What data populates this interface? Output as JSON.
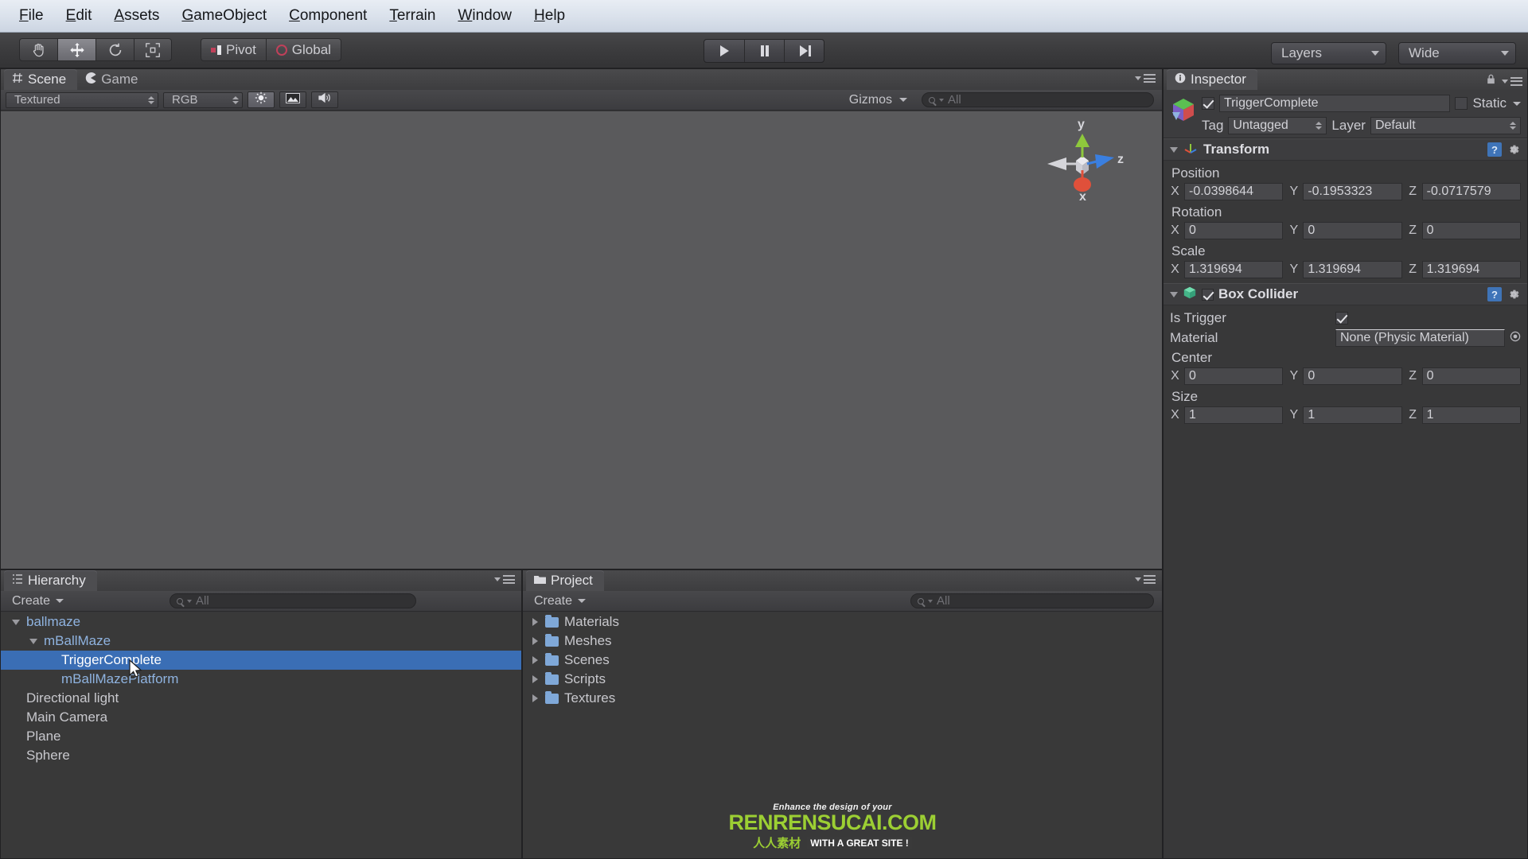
{
  "app": {
    "title": "Unity Editor"
  },
  "menubar": {
    "items": [
      {
        "label": "File",
        "mnemonic": "F"
      },
      {
        "label": "Edit",
        "mnemonic": "E"
      },
      {
        "label": "Assets",
        "mnemonic": "A"
      },
      {
        "label": "GameObject",
        "mnemonic": "G"
      },
      {
        "label": "Component",
        "mnemonic": "C"
      },
      {
        "label": "Terrain",
        "mnemonic": "T"
      },
      {
        "label": "Window",
        "mnemonic": "W"
      },
      {
        "label": "Help",
        "mnemonic": "H"
      }
    ]
  },
  "toolbar": {
    "tools": [
      {
        "name": "hand-tool",
        "icon": "hand-icon",
        "active": false
      },
      {
        "name": "move-tool",
        "icon": "move-arrows-icon",
        "active": true
      },
      {
        "name": "rotate-tool",
        "icon": "rotate-icon",
        "active": false
      },
      {
        "name": "scale-tool",
        "icon": "scale-icon",
        "active": false
      }
    ],
    "pivot_label": "Pivot",
    "global_label": "Global",
    "play_label": "Play",
    "pause_label": "Pause",
    "step_label": "Step",
    "layers_label": "Layers",
    "layout_label": "Wide"
  },
  "scene_panel": {
    "tabs": [
      {
        "label": "Scene",
        "icon": "scene-grid-icon",
        "active": true
      },
      {
        "label": "Game",
        "icon": "game-pacman-icon",
        "active": false
      }
    ],
    "draw_mode": "Textured",
    "render_mode": "RGB",
    "lighting_toggle": "sun-icon",
    "fx_toggle": "image-icon",
    "audio_toggle": "speaker-icon",
    "gizmos_label": "Gizmos",
    "search_placeholder": "All",
    "search_value": "",
    "gizmo_axes": {
      "y": "y",
      "z": "z",
      "x": "x"
    }
  },
  "hierarchy_panel": {
    "tab_label": "Hierarchy",
    "tab_icon": "hierarchy-list-icon",
    "create_label": "Create",
    "search_placeholder": "All",
    "search_value": "",
    "items": [
      {
        "label": "ballmaze",
        "depth": 0,
        "expander": "down",
        "prefab": true,
        "selected": false
      },
      {
        "label": "mBallMaze",
        "depth": 1,
        "expander": "down",
        "prefab": true,
        "selected": false
      },
      {
        "label": "TriggerComplete",
        "depth": 2,
        "expander": "none",
        "prefab": true,
        "selected": true
      },
      {
        "label": "mBallMazePlatform",
        "depth": 2,
        "expander": "none",
        "prefab": true,
        "selected": false
      },
      {
        "label": "Directional light",
        "depth": 0,
        "expander": "none",
        "prefab": false,
        "selected": false
      },
      {
        "label": "Main Camera",
        "depth": 0,
        "expander": "none",
        "prefab": false,
        "selected": false
      },
      {
        "label": "Plane",
        "depth": 0,
        "expander": "none",
        "prefab": false,
        "selected": false
      },
      {
        "label": "Sphere",
        "depth": 0,
        "expander": "none",
        "prefab": false,
        "selected": false
      }
    ]
  },
  "project_panel": {
    "tab_label": "Project",
    "tab_icon": "folder-icon",
    "create_label": "Create",
    "search_placeholder": "All",
    "search_value": "",
    "items": [
      {
        "label": "Materials",
        "expander": "right",
        "icon": "folder-icon"
      },
      {
        "label": "Meshes",
        "expander": "right",
        "icon": "folder-icon"
      },
      {
        "label": "Scenes",
        "expander": "right",
        "icon": "folder-icon"
      },
      {
        "label": "Scripts",
        "expander": "right",
        "icon": "folder-icon"
      },
      {
        "label": "Textures",
        "expander": "right",
        "icon": "folder-icon"
      }
    ]
  },
  "inspector": {
    "tab_label": "Inspector",
    "tab_icon": "info-icon",
    "lock_icon": "lock-icon",
    "object_name": "TriggerComplete",
    "object_enabled": true,
    "static_label": "Static",
    "static_checked": false,
    "tag_label": "Tag",
    "tag_value": "Untagged",
    "layer_label": "Layer",
    "layer_value": "Default",
    "components": [
      {
        "name": "Transform",
        "icon": "transform-axis-icon",
        "has_enable_checkbox": false,
        "enabled": true,
        "expanded": true,
        "properties": [
          {
            "label": "Position",
            "type": "vector3",
            "x": "-0.0398644",
            "y": "-0.1953323",
            "z": "-0.0717579"
          },
          {
            "label": "Rotation",
            "type": "vector3",
            "x": "0",
            "y": "0",
            "z": "0"
          },
          {
            "label": "Scale",
            "type": "vector3",
            "x": "1.319694",
            "y": "1.319694",
            "z": "1.319694"
          }
        ]
      },
      {
        "name": "Box Collider",
        "icon": "box-collider-icon",
        "has_enable_checkbox": true,
        "enabled": true,
        "expanded": true,
        "properties": [
          {
            "label": "Is Trigger",
            "type": "checkbox",
            "checked": true
          },
          {
            "label": "Material",
            "type": "object",
            "value": "None (Physic Material)"
          },
          {
            "label": "Center",
            "type": "vector3",
            "x": "0",
            "y": "0",
            "z": "0"
          },
          {
            "label": "Size",
            "type": "vector3",
            "x": "1",
            "y": "1",
            "z": "1"
          }
        ]
      }
    ]
  },
  "watermark": {
    "line1": "Enhance the design of your",
    "line2": "RENRENSUCAI.COM",
    "line3": "人人素材",
    "line4": "WITH A GREAT SITE !"
  },
  "colors": {
    "selection_blue": "#3a6eb5",
    "prefab_blue": "#8fb3e0",
    "panel_bg": "#383839",
    "toolbar_bg": "#3c3c3e",
    "axis_x": "#e0503a",
    "axis_y": "#8ec83c",
    "axis_z": "#3a7fe0",
    "maze_red": "#a05a5a",
    "floor_magenta": "#c328c8"
  }
}
